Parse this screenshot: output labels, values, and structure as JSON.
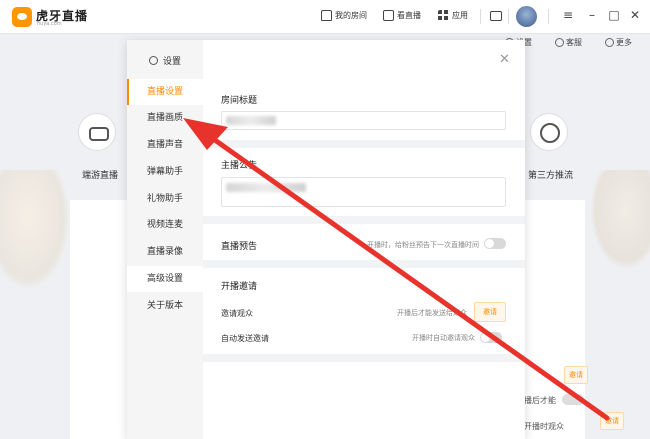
{
  "app": {
    "name": "虎牙直播",
    "domain": "huya.com"
  },
  "topbar": {
    "nav": [
      "我的房间",
      "看直播",
      "应用"
    ],
    "icons": [
      "house-icon",
      "play-icon",
      "apps-grid-icon",
      "message-icon"
    ],
    "window_controls": [
      "≡",
      "–",
      "□",
      "✕"
    ]
  },
  "background": {
    "subnav": [
      "设置",
      "客服",
      "更多"
    ],
    "tiles": [
      "端游直播",
      "第三方推流"
    ],
    "rows": {
      "invite_text": "开播后才能",
      "audience_text": "开播时观众",
      "invite_button": "邀请"
    }
  },
  "settings": {
    "title": "设置",
    "active_index": 0,
    "menu": [
      "直播设置",
      "直播画质",
      "直播声音",
      "弹幕助手",
      "礼物助手",
      "视频连麦",
      "直播录像",
      "高级设置",
      "关于版本"
    ],
    "room_title": {
      "label": "房间标题"
    },
    "announcement": {
      "label": "主播公告"
    },
    "preview": {
      "label": "直播预告",
      "hint": "开播时，给粉丝预告下一次直播时间",
      "enabled": false
    },
    "invite": {
      "section_label": "开播邀请",
      "invite_audience": {
        "label": "邀请观众",
        "hint": "开播后才能发送给观众",
        "button": "邀请"
      },
      "auto_invite": {
        "label": "自动发送邀请",
        "hint": "开播时自动邀请观众",
        "enabled": false
      }
    }
  },
  "annotation": {
    "color": "#e8322c"
  },
  "colors": {
    "accent": "#ff8a00",
    "brand": "#ff9600"
  }
}
